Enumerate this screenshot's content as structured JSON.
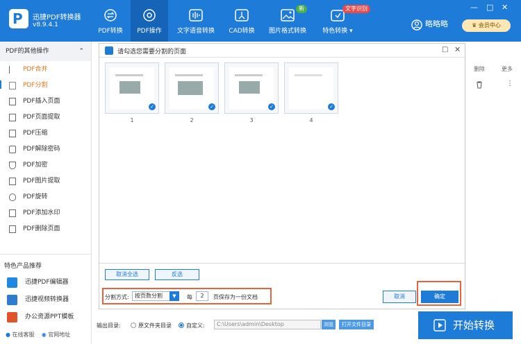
{
  "app": {
    "name": "迅捷PDF转换器",
    "version": "v8.9.4.1",
    "user": "略略略",
    "member_label": "会员中心"
  },
  "tabs": [
    {
      "label": "PDF转换"
    },
    {
      "label": "PDF操作"
    },
    {
      "label": "文字语音转换"
    },
    {
      "label": "CAD转换"
    },
    {
      "label": "图片格式转换",
      "badge": "新"
    },
    {
      "label": "特色转换",
      "badge": "文字识别"
    }
  ],
  "window_controls": {
    "minimize": "—",
    "maximize": "□",
    "close": "✕"
  },
  "sidebar": {
    "header": "PDF的其他操作",
    "items": [
      {
        "label": "PDF合并"
      },
      {
        "label": "PDF分割"
      },
      {
        "label": "PDF插入页面"
      },
      {
        "label": "PDF页面提取"
      },
      {
        "label": "PDF压缩"
      },
      {
        "label": "PDF解除密码"
      },
      {
        "label": "PDF加密"
      },
      {
        "label": "PDF图片提取"
      },
      {
        "label": "PDF旋转"
      },
      {
        "label": "PDF添加水印"
      },
      {
        "label": "PDF删除页面"
      }
    ],
    "special_header": "特色产品推荐",
    "products": [
      {
        "label": "迅捷PDF编辑器",
        "color": "#1e88e5"
      },
      {
        "label": "迅捷视频转换器",
        "color": "#2e7bd0"
      },
      {
        "label": "办公资源PPT模板",
        "color": "#e0532b"
      }
    ],
    "footer": {
      "service": "在线客服",
      "website": "官网地址"
    }
  },
  "right_panel": {
    "delete_label": "删除",
    "more_label": "更多"
  },
  "modal": {
    "title": "请勾选您需要分割的页面",
    "pages": [
      "1",
      "2",
      "3",
      "4"
    ],
    "deselect_all": "取消全选",
    "invert": "反选",
    "split_label": "分割方式:",
    "split_mode": "按页数分割",
    "every_label": "每",
    "pages_per_doc": "2",
    "save_label": "页保存为一份文档",
    "cancel": "取消",
    "confirm": "确定"
  },
  "bottom": {
    "output_label": "输出目录:",
    "option_original": "原文件夹目录",
    "option_custom": "自定义:",
    "path": "C:\\Users\\admin\\Desktop",
    "browse": "浏览",
    "open_folder": "打开文件目录",
    "start": "开始转换"
  },
  "colors": {
    "brand": "#1e7bd8",
    "highlight": "#e6643c",
    "active_text": "#e07a1b"
  }
}
